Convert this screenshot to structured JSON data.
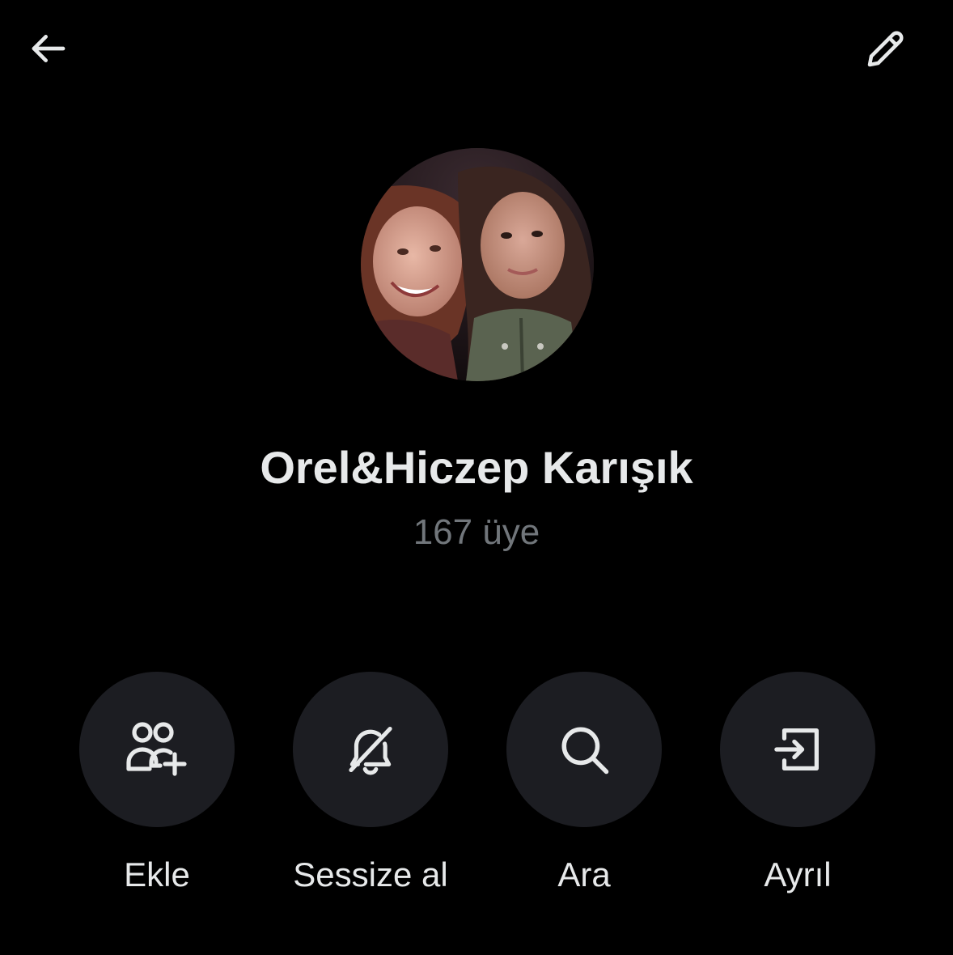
{
  "header": {
    "back_icon": "arrow-left-icon",
    "edit_icon": "pencil-icon"
  },
  "group": {
    "name": "Orel&Hiczep Karışık",
    "member_count": "167 üye",
    "avatar_icon": "group-photo"
  },
  "actions": [
    {
      "label": "Ekle",
      "icon": "add-people-icon"
    },
    {
      "label": "Sessize al",
      "icon": "bell-slash-icon"
    },
    {
      "label": "Ara",
      "icon": "search-icon"
    },
    {
      "label": "Ayrıl",
      "icon": "leave-icon"
    }
  ],
  "colors": {
    "background": "#000000",
    "text_primary": "#e7e9ea",
    "text_secondary": "#71767b",
    "button_bg": "#1c1d22"
  }
}
